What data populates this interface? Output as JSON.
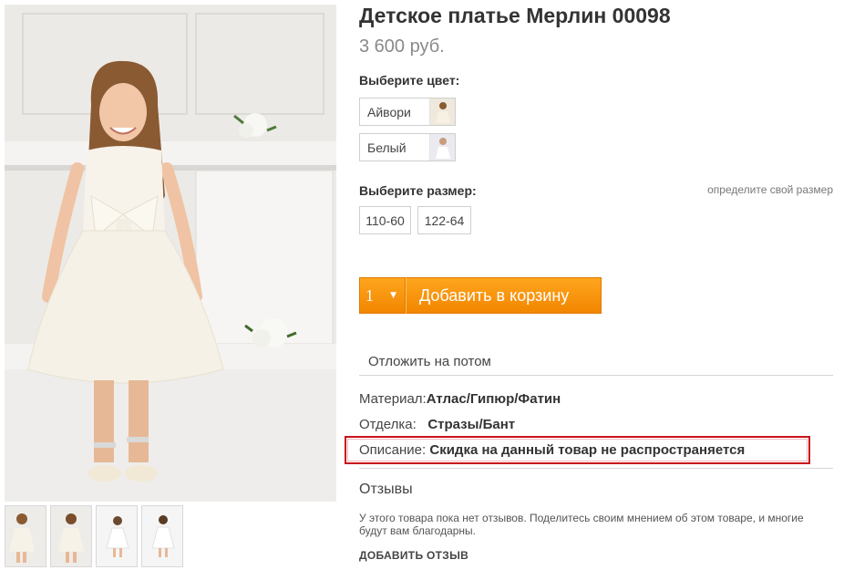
{
  "product": {
    "title": "Детское платье Мерлин 00098",
    "price": "3 600 руб."
  },
  "color": {
    "label": "Выберите цвет:",
    "options": [
      {
        "name": "Айвори"
      },
      {
        "name": "Белый"
      }
    ]
  },
  "size": {
    "label": "Выберите размер:",
    "help_link": "определите свой размер",
    "options": [
      "110-60",
      "122-64"
    ]
  },
  "cart": {
    "quantity": "1",
    "add_label": "Добавить в корзину"
  },
  "wishlist": {
    "label": "Отложить на потом"
  },
  "properties": [
    {
      "name": "Материал:",
      "value": "Атлас/Гипюр/Фатин"
    },
    {
      "name": "Отделка:",
      "value": "Стразы/Бант"
    },
    {
      "name": "Описание:",
      "value": "Скидка на данный товар не распространяется"
    }
  ],
  "reviews": {
    "title": "Отзывы",
    "empty_text": "У этого товара пока нет отзывов. Поделитесь своим мнением об этом товаре, и многие будут вам благодарны.",
    "add_label": "ДОБАВИТЬ ОТЗЫВ"
  },
  "colors": {
    "accent_orange": "#f28600",
    "highlight_red": "#c8141b",
    "price_gray": "#8a8a8a"
  }
}
